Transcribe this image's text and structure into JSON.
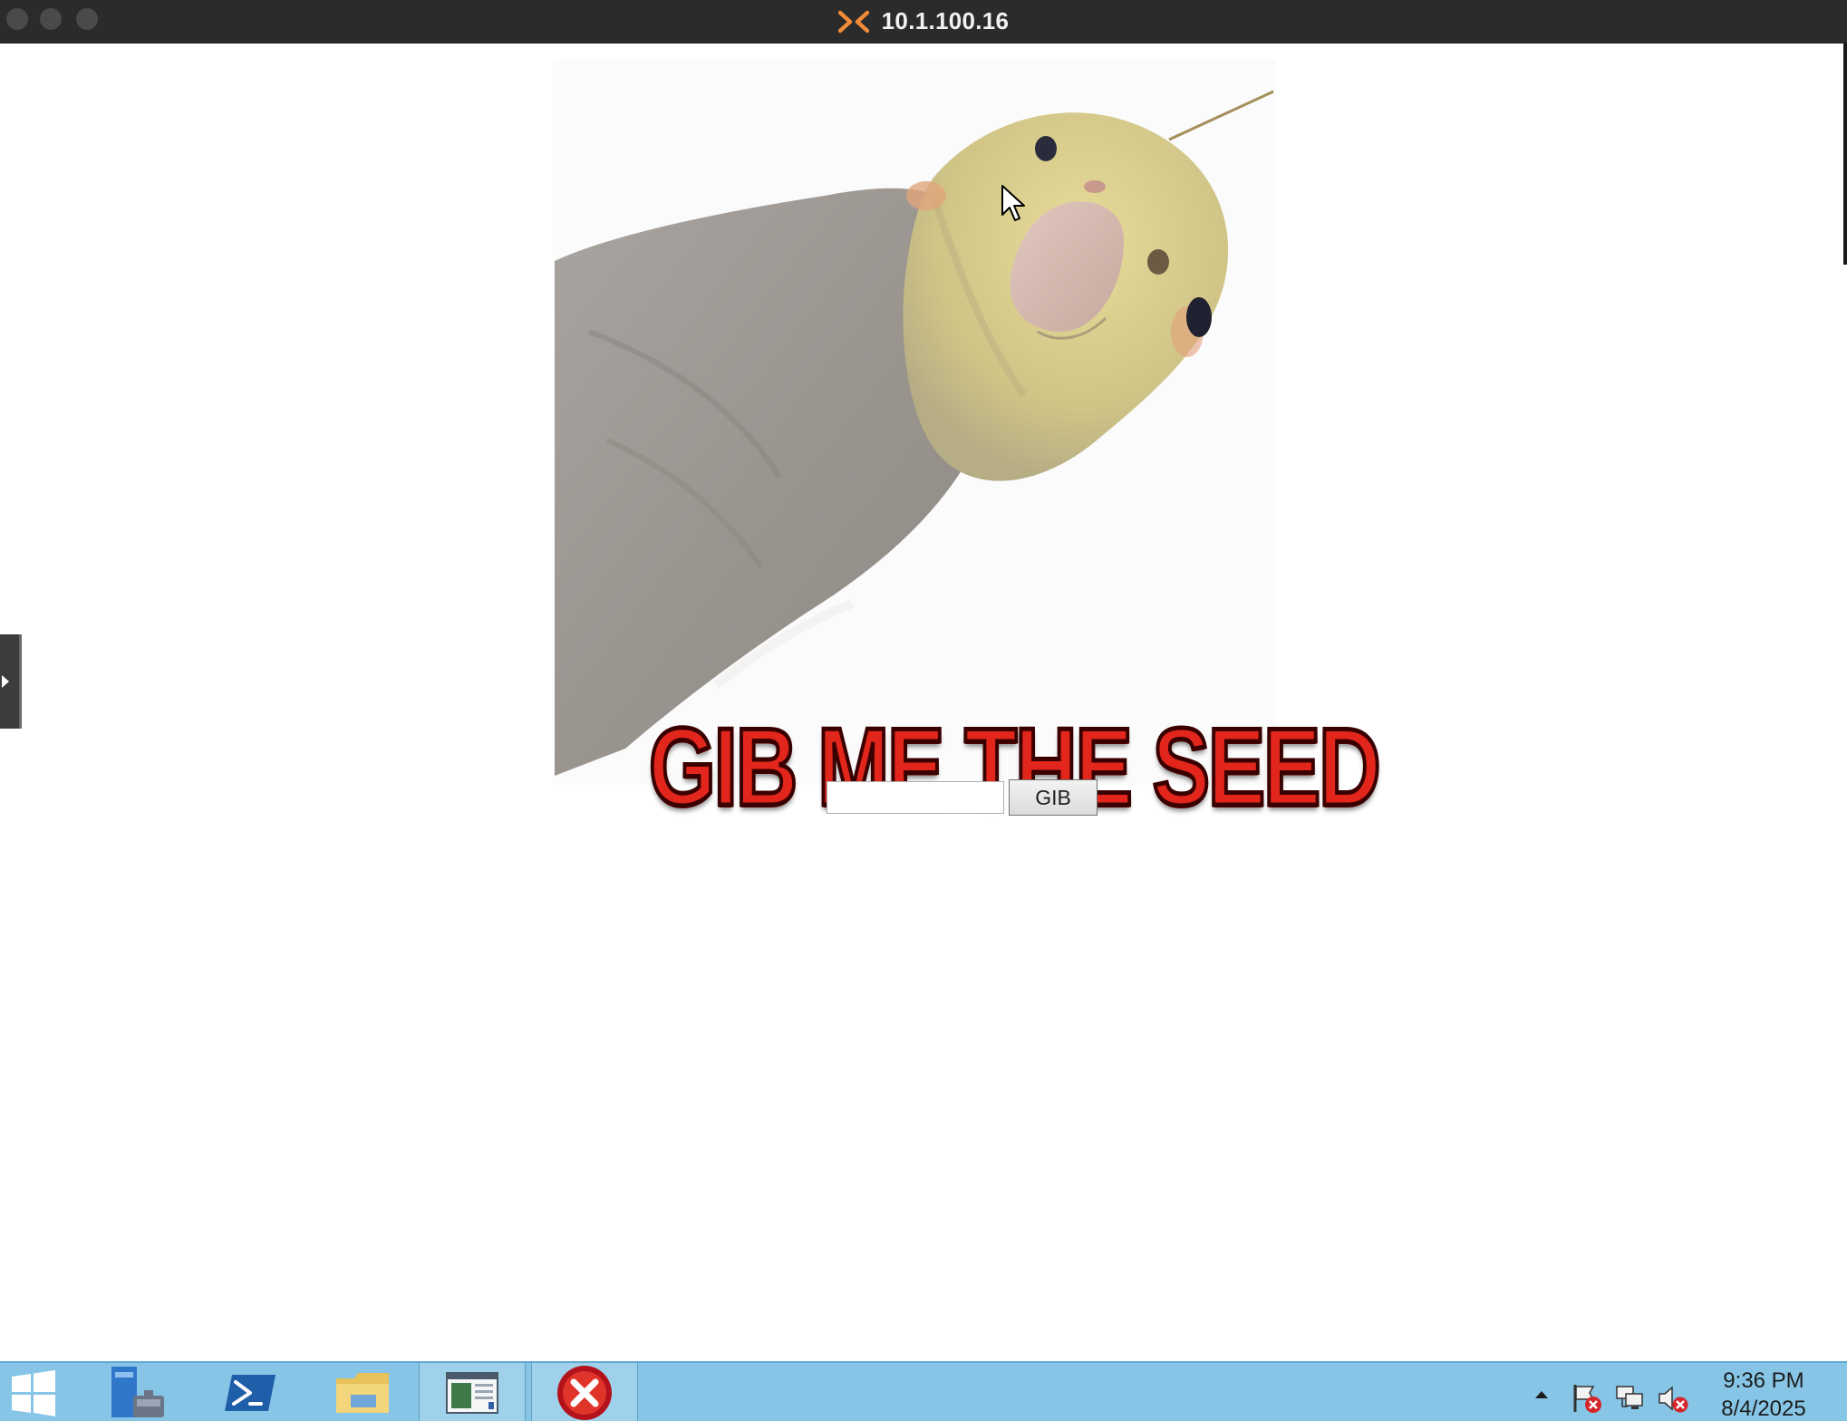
{
  "window": {
    "title": "10.1.100.16",
    "logo_icon": "rdp-x-logo",
    "logo_color": "#f08b3a"
  },
  "meme": {
    "image_description_icon": "cockatiel-photo",
    "caption": "GIB ME THE SEED",
    "caption_color": "#e3261b"
  },
  "form": {
    "input_value": "",
    "button_label": "GIB"
  },
  "taskbar": {
    "apps": [
      {
        "icon": "windows-start-icon"
      },
      {
        "icon": "server-manager-icon"
      },
      {
        "icon": "powershell-icon"
      },
      {
        "icon": "file-explorer-icon"
      },
      {
        "icon": "browser-window-icon"
      },
      {
        "icon": "error-x-icon"
      }
    ],
    "tray": [
      {
        "icon": "chevron-up-icon"
      },
      {
        "icon": "action-center-flag-icon"
      },
      {
        "icon": "network-icon"
      },
      {
        "icon": "speaker-muted-icon"
      }
    ],
    "time": "9:36 PM",
    "date": "8/4/2025",
    "color": "#86c5e6"
  }
}
